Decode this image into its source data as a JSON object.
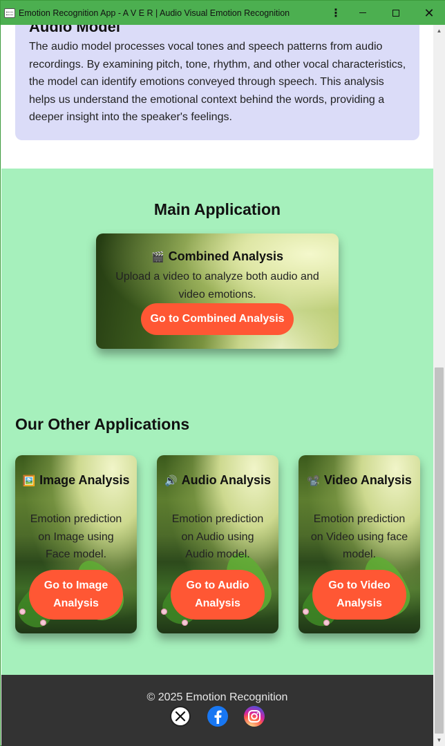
{
  "window": {
    "title": "Emotion Recognition App - A V E R | Audio Visual Emotion Recognition",
    "icon": "app-window-icon"
  },
  "audio_model": {
    "heading": "Audio Model",
    "description": "The audio model processes vocal tones and speech patterns from audio recordings. By examining pitch, tone, rhythm, and other vocal characteristics, the model can identify emotions conveyed through speech. This analysis helps us understand the emotional context behind the words, providing a deeper insight into the speaker's feelings."
  },
  "main_application": {
    "heading": "Main Application",
    "card": {
      "icon": "🎬",
      "title": "Combined Analysis",
      "description": "Upload a video to analyze both audio and video emotions.",
      "button": "Go to Combined Analysis"
    }
  },
  "other_applications": {
    "heading": "Our Other Applications",
    "cards": [
      {
        "icon": "🖼️",
        "title": "Image Analysis",
        "description": "Emotion prediction on Image using Face model.",
        "button": "Go to Image Analysis"
      },
      {
        "icon": "🔊",
        "title": "Audio Analysis",
        "description": "Emotion prediction on Audio using Audio model.",
        "button": "Go to Audio Analysis"
      },
      {
        "icon": "📽️",
        "title": "Video Analysis",
        "description": "Emotion prediction on Video using face model.",
        "button": "Go to Video Analysis"
      }
    ]
  },
  "footer": {
    "copyright": "© 2025 Emotion Recognition",
    "social": [
      "x-icon",
      "facebook-icon",
      "instagram-icon"
    ]
  },
  "colors": {
    "titlebar": "#4caf50",
    "audio_card": "#dbdcf8",
    "green_section": "#a6f0bc",
    "button": "#ff5734",
    "footer": "#333333"
  }
}
